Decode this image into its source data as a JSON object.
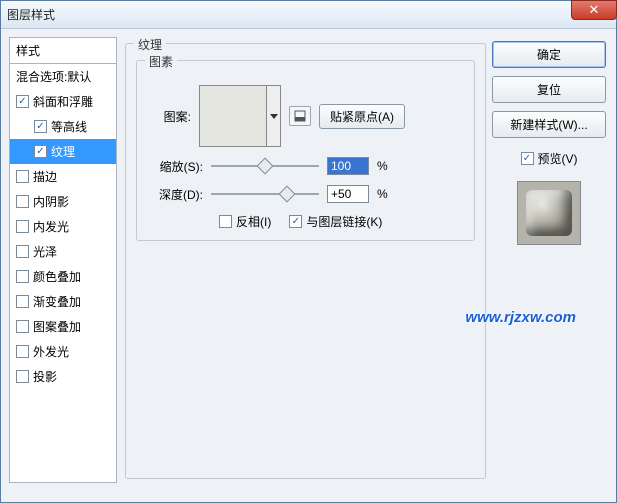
{
  "window": {
    "title": "图层样式"
  },
  "styles": {
    "header": "样式",
    "blending": "混合选项:默认",
    "items": [
      {
        "label": "斜面和浮雕",
        "checked": true,
        "selected": false,
        "sub": false
      },
      {
        "label": "等高线",
        "checked": true,
        "selected": false,
        "sub": true
      },
      {
        "label": "纹理",
        "checked": true,
        "selected": true,
        "sub": true
      },
      {
        "label": "描边",
        "checked": false,
        "selected": false,
        "sub": false
      },
      {
        "label": "内阴影",
        "checked": false,
        "selected": false,
        "sub": false
      },
      {
        "label": "内发光",
        "checked": false,
        "selected": false,
        "sub": false
      },
      {
        "label": "光泽",
        "checked": false,
        "selected": false,
        "sub": false
      },
      {
        "label": "颜色叠加",
        "checked": false,
        "selected": false,
        "sub": false
      },
      {
        "label": "渐变叠加",
        "checked": false,
        "selected": false,
        "sub": false
      },
      {
        "label": "图案叠加",
        "checked": false,
        "selected": false,
        "sub": false
      },
      {
        "label": "外发光",
        "checked": false,
        "selected": false,
        "sub": false
      },
      {
        "label": "投影",
        "checked": false,
        "selected": false,
        "sub": false
      }
    ]
  },
  "texture": {
    "group_label": "纹理",
    "pattern_group_label": "图素",
    "pattern_label": "图案:",
    "snap_button": "贴紧原点(A)",
    "scale_label": "缩放(S):",
    "scale_value": "100",
    "scale_unit": "%",
    "depth_label": "深度(D):",
    "depth_value": "+50",
    "depth_unit": "%",
    "invert_label": "反相(I)",
    "invert_checked": false,
    "link_label": "与图层链接(K)",
    "link_checked": true
  },
  "buttons": {
    "ok": "确定",
    "cancel": "复位",
    "new_style": "新建样式(W)...",
    "preview": "预览(V)",
    "preview_checked": true
  },
  "watermark": "www.rjzxw.com"
}
